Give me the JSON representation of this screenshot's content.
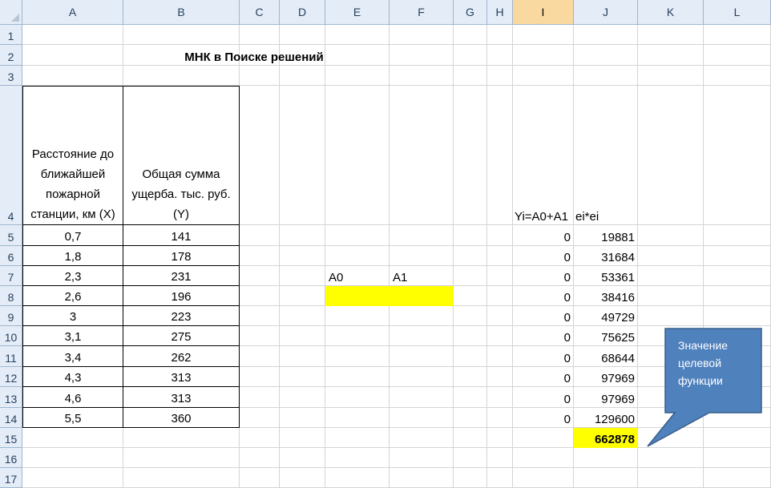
{
  "columns": [
    "A",
    "B",
    "C",
    "D",
    "E",
    "F",
    "G",
    "H",
    "I",
    "J",
    "K",
    "L"
  ],
  "rows": [
    "1",
    "2",
    "3",
    "4",
    "5",
    "6",
    "7",
    "8",
    "9",
    "10",
    "11",
    "12",
    "13",
    "14",
    "15",
    "16",
    "17"
  ],
  "title": "МНК в Поиске решений",
  "header_x": "Расстояние до ближайшей пожарной станции, км (X)",
  "header_y": "Общая сумма ущерба. тыс. руб. (Y)",
  "label_yi": "Yi=A0+A1",
  "label_ee": "ei*ei",
  "label_a0": "A0",
  "label_a1": "A1",
  "x_values": [
    "0,7",
    "1,8",
    "2,3",
    "2,6",
    "3",
    "3,1",
    "3,4",
    "4,3",
    "4,6",
    "5,5"
  ],
  "y_values": [
    "141",
    "178",
    "231",
    "196",
    "223",
    "275",
    "262",
    "313",
    "313",
    "360"
  ],
  "yi_values": [
    "0",
    "0",
    "0",
    "0",
    "0",
    "0",
    "0",
    "0",
    "0",
    "0"
  ],
  "ee_values": [
    "19881",
    "31684",
    "53361",
    "38416",
    "49729",
    "75625",
    "68644",
    "97969",
    "97969",
    "129600"
  ],
  "total": "662878",
  "callout_text": "Значение целевой функции",
  "colors": {
    "highlight": "#ffff00",
    "callout_fill": "#4f81bd",
    "callout_border": "#385d8a",
    "header_bg": "#e4ecf7",
    "selected_header": "#f9d99f"
  }
}
